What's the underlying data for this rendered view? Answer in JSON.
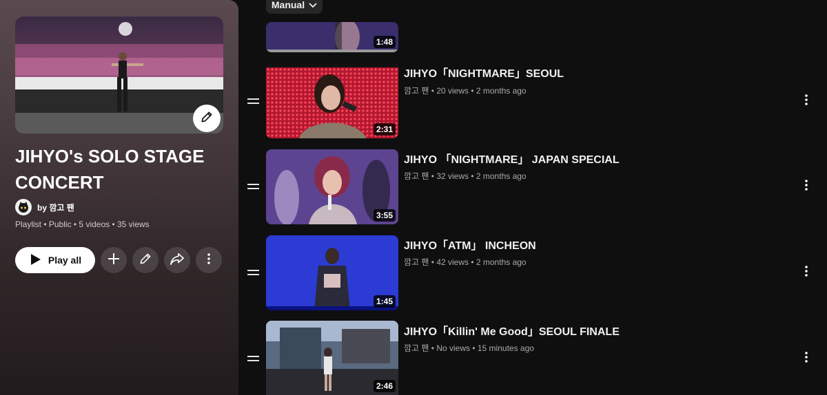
{
  "playlist": {
    "title": "JIHYO's SOLO STAGE CONCERT",
    "owner": "by 깜고 팬",
    "meta": "Playlist • Public • 5 videos • 35 views",
    "play_all_label": "Play all"
  },
  "sort": {
    "label": "Manual"
  },
  "videos": [
    {
      "title": "",
      "meta": "",
      "duration": "1:48"
    },
    {
      "title": "JIHYO「NIGHTMARE」SEOUL",
      "meta": "깜고 팬 • 20 views • 2 months ago",
      "duration": "2:31"
    },
    {
      "title": "JIHYO 「NIGHTMARE」 JAPAN SPECIAL",
      "meta": "깜고 팬 • 32 views • 2 months ago",
      "duration": "3:55"
    },
    {
      "title": "JIHYO「ATM」 INCHEON",
      "meta": "깜고 팬 • 42 views • 2 months ago",
      "duration": "1:45"
    },
    {
      "title": "JIHYO「Killin' Me Good」SEOUL FINALE",
      "meta": "깜고 팬 • No views • 15 minutes ago",
      "duration": "2:46"
    }
  ],
  "icons": {
    "play": "play-icon",
    "add": "plus-icon",
    "edit": "pencil-icon",
    "share": "share-icon",
    "more": "more-vert-icon",
    "sort": "chevron-down-icon",
    "drag": "drag-handle-icon"
  },
  "colors": {
    "panel_top": "#5a4a50",
    "panel_bottom": "#221b1d",
    "background": "#0f0f0f"
  }
}
